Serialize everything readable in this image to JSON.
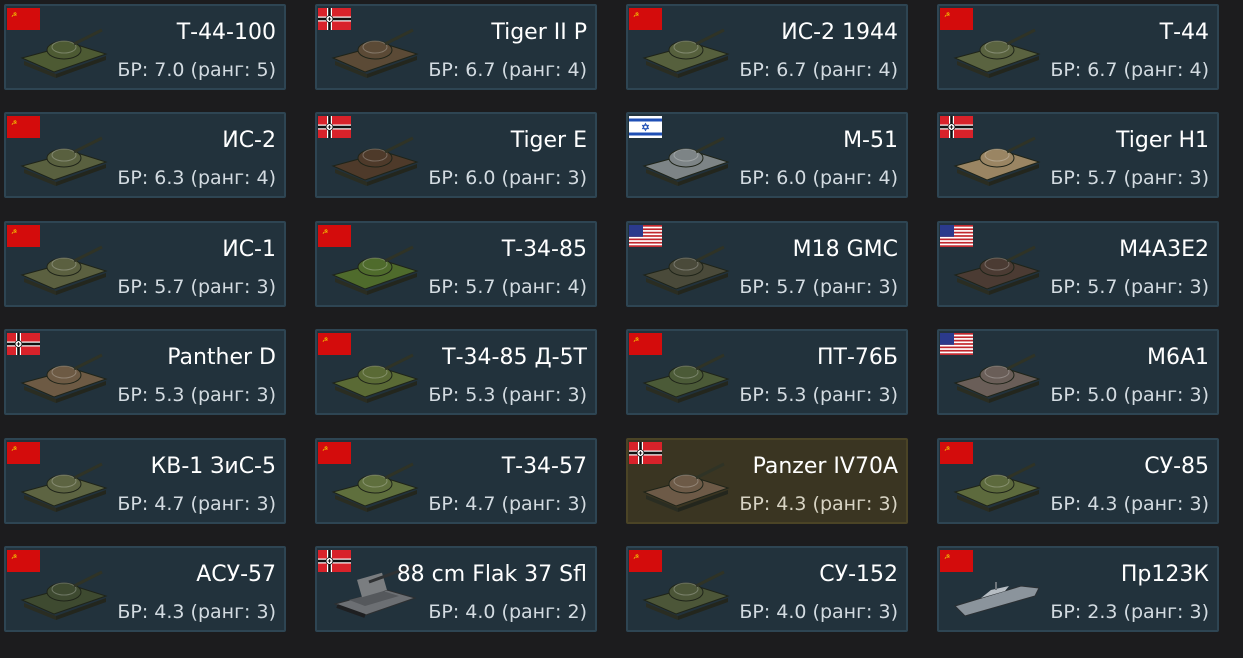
{
  "vehicles": [
    {
      "name": "Т-44-100",
      "br": "БР: 7.0 (ранг: 5)",
      "nation": "ussr",
      "kind": "tank",
      "color": "#4d5a33",
      "icon": "tank-icon"
    },
    {
      "name": "Tiger II P",
      "br": "БР: 6.7 (ранг: 4)",
      "nation": "germany",
      "kind": "tank",
      "color": "#5b4a36",
      "icon": "tank-icon"
    },
    {
      "name": "ИС-2 1944",
      "br": "БР: 6.7 (ранг: 4)",
      "nation": "ussr",
      "kind": "tank",
      "color": "#56603d",
      "icon": "tank-icon"
    },
    {
      "name": "Т-44",
      "br": "БР: 6.7 (ранг: 4)",
      "nation": "ussr",
      "kind": "tank",
      "color": "#5a6340",
      "icon": "tank-icon"
    },
    {
      "name": "ИС-2",
      "br": "БР: 6.3 (ранг: 4)",
      "nation": "ussr",
      "kind": "tank",
      "color": "#59603f",
      "icon": "tank-icon"
    },
    {
      "name": "Tiger E",
      "br": "БР: 6.0 (ранг: 3)",
      "nation": "germany",
      "kind": "tank",
      "color": "#4e3a2a",
      "icon": "tank-icon"
    },
    {
      "name": "M-51",
      "br": "БР: 6.0 (ранг: 4)",
      "nation": "israel",
      "kind": "tank",
      "color": "#7d8486",
      "icon": "tank-icon"
    },
    {
      "name": "Tiger H1",
      "br": "БР: 5.7 (ранг: 3)",
      "nation": "germany",
      "kind": "tank",
      "color": "#9a8563",
      "icon": "tank-icon"
    },
    {
      "name": "ИС-1",
      "br": "БР: 5.7 (ранг: 3)",
      "nation": "ussr",
      "kind": "tank",
      "color": "#5b6040",
      "icon": "tank-icon"
    },
    {
      "name": "Т-34-85",
      "br": "БР: 5.7 (ранг: 4)",
      "nation": "ussr",
      "kind": "tank",
      "color": "#4f6b2c",
      "icon": "tank-icon"
    },
    {
      "name": "M18 GMC",
      "br": "БР: 5.7 (ранг: 3)",
      "nation": "usa",
      "kind": "tank",
      "color": "#4a4a3a",
      "icon": "tank-icon"
    },
    {
      "name": "M4A3E2",
      "br": "БР: 5.7 (ранг: 3)",
      "nation": "usa",
      "kind": "tank",
      "color": "#4b3b33",
      "icon": "tank-icon"
    },
    {
      "name": "Panther D",
      "br": "БР: 5.3 (ранг: 3)",
      "nation": "germany",
      "kind": "tank",
      "color": "#6d5a44",
      "icon": "tank-icon"
    },
    {
      "name": "Т-34-85 Д-5Т",
      "br": "БР: 5.3 (ранг: 3)",
      "nation": "ussr",
      "kind": "tank",
      "color": "#5a6a35",
      "icon": "tank-icon"
    },
    {
      "name": "ПТ-76Б",
      "br": "БР: 5.3 (ранг: 3)",
      "nation": "ussr",
      "kind": "tank",
      "color": "#4b5a37",
      "icon": "tank-icon"
    },
    {
      "name": "M6A1",
      "br": "БР: 5.0 (ранг: 3)",
      "nation": "usa",
      "kind": "tank",
      "color": "#6a5e58",
      "icon": "tank-icon"
    },
    {
      "name": "КВ-1 ЗиС-5",
      "br": "БР: 4.7 (ранг: 3)",
      "nation": "ussr",
      "kind": "tank",
      "color": "#5d6442",
      "icon": "tank-icon"
    },
    {
      "name": "Т-34-57",
      "br": "БР: 4.7 (ранг: 3)",
      "nation": "ussr",
      "kind": "tank",
      "color": "#5f6f3d",
      "icon": "tank-icon"
    },
    {
      "name": "Panzer IV70A",
      "br": "БР: 4.3 (ранг: 3)",
      "nation": "germany",
      "kind": "tank",
      "color": "#6d5a47",
      "icon": "tank-icon",
      "highlight": true
    },
    {
      "name": "СУ-85",
      "br": "БР: 4.3 (ранг: 3)",
      "nation": "ussr",
      "kind": "tank",
      "color": "#5d6a3d",
      "icon": "tank-icon"
    },
    {
      "name": "АСУ-57",
      "br": "БР: 4.3 (ранг: 3)",
      "nation": "ussr",
      "kind": "tank",
      "color": "#3e4a30",
      "icon": "tank-icon"
    },
    {
      "name": "88 cm Flak 37 Sfl",
      "br": "БР: 4.0 (ранг: 2)",
      "nation": "germany",
      "kind": "spaa",
      "color": "#6c6f73",
      "icon": "spaa-icon"
    },
    {
      "name": "СУ-152",
      "br": "БР: 4.0 (ранг: 3)",
      "nation": "ussr",
      "kind": "tank",
      "color": "#4c5638",
      "icon": "tank-icon"
    },
    {
      "name": "Пр123К",
      "br": "БР: 2.3 (ранг: 3)",
      "nation": "ussr",
      "kind": "boat",
      "color": "#8b949c",
      "icon": "boat-icon"
    }
  ]
}
